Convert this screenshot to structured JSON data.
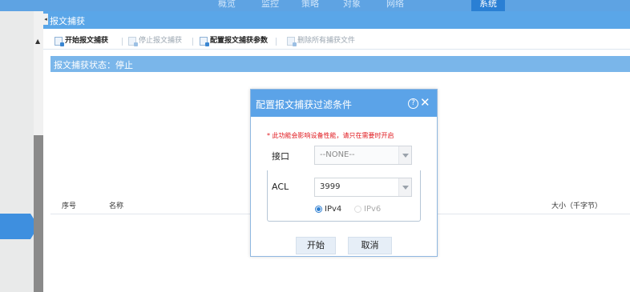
{
  "top_nav": {
    "tabs": [
      {
        "label": "概览",
        "active": false
      },
      {
        "label": "监控",
        "active": false
      },
      {
        "label": "策略",
        "active": false
      },
      {
        "label": "对象",
        "active": false
      },
      {
        "label": "网络",
        "active": false
      },
      {
        "label": "系统",
        "active": true
      }
    ]
  },
  "panel": {
    "title": "报文捕获"
  },
  "toolbar": {
    "start": "开始报文捕获",
    "stop": "停止报文捕获",
    "configure": "配置报文捕获参数",
    "delete_all": "删除所有捕获文件"
  },
  "status": {
    "text": "报文捕获状态：停止"
  },
  "table": {
    "columns": [
      "序号",
      "名称",
      "大小（千字节）"
    ]
  },
  "dialog": {
    "title": "配置报文捕获过滤条件",
    "warning": "* 此功能会影响设备性能，请只在需要时开启",
    "interface_label": "接口",
    "interface_value": "--NONE--",
    "acl_label": "ACL",
    "acl_value": "3999",
    "ip_options": [
      "IPv4",
      "IPv6"
    ],
    "ip_selected": "IPv4",
    "start_button": "开始",
    "cancel_button": "取消"
  },
  "colors": {
    "nav_bg": "#5ea3e3",
    "panel_header": "#5aa6e8",
    "status_bg": "#7ab6ea",
    "warning": "#e0181e",
    "accent": "#2e7fd1"
  }
}
